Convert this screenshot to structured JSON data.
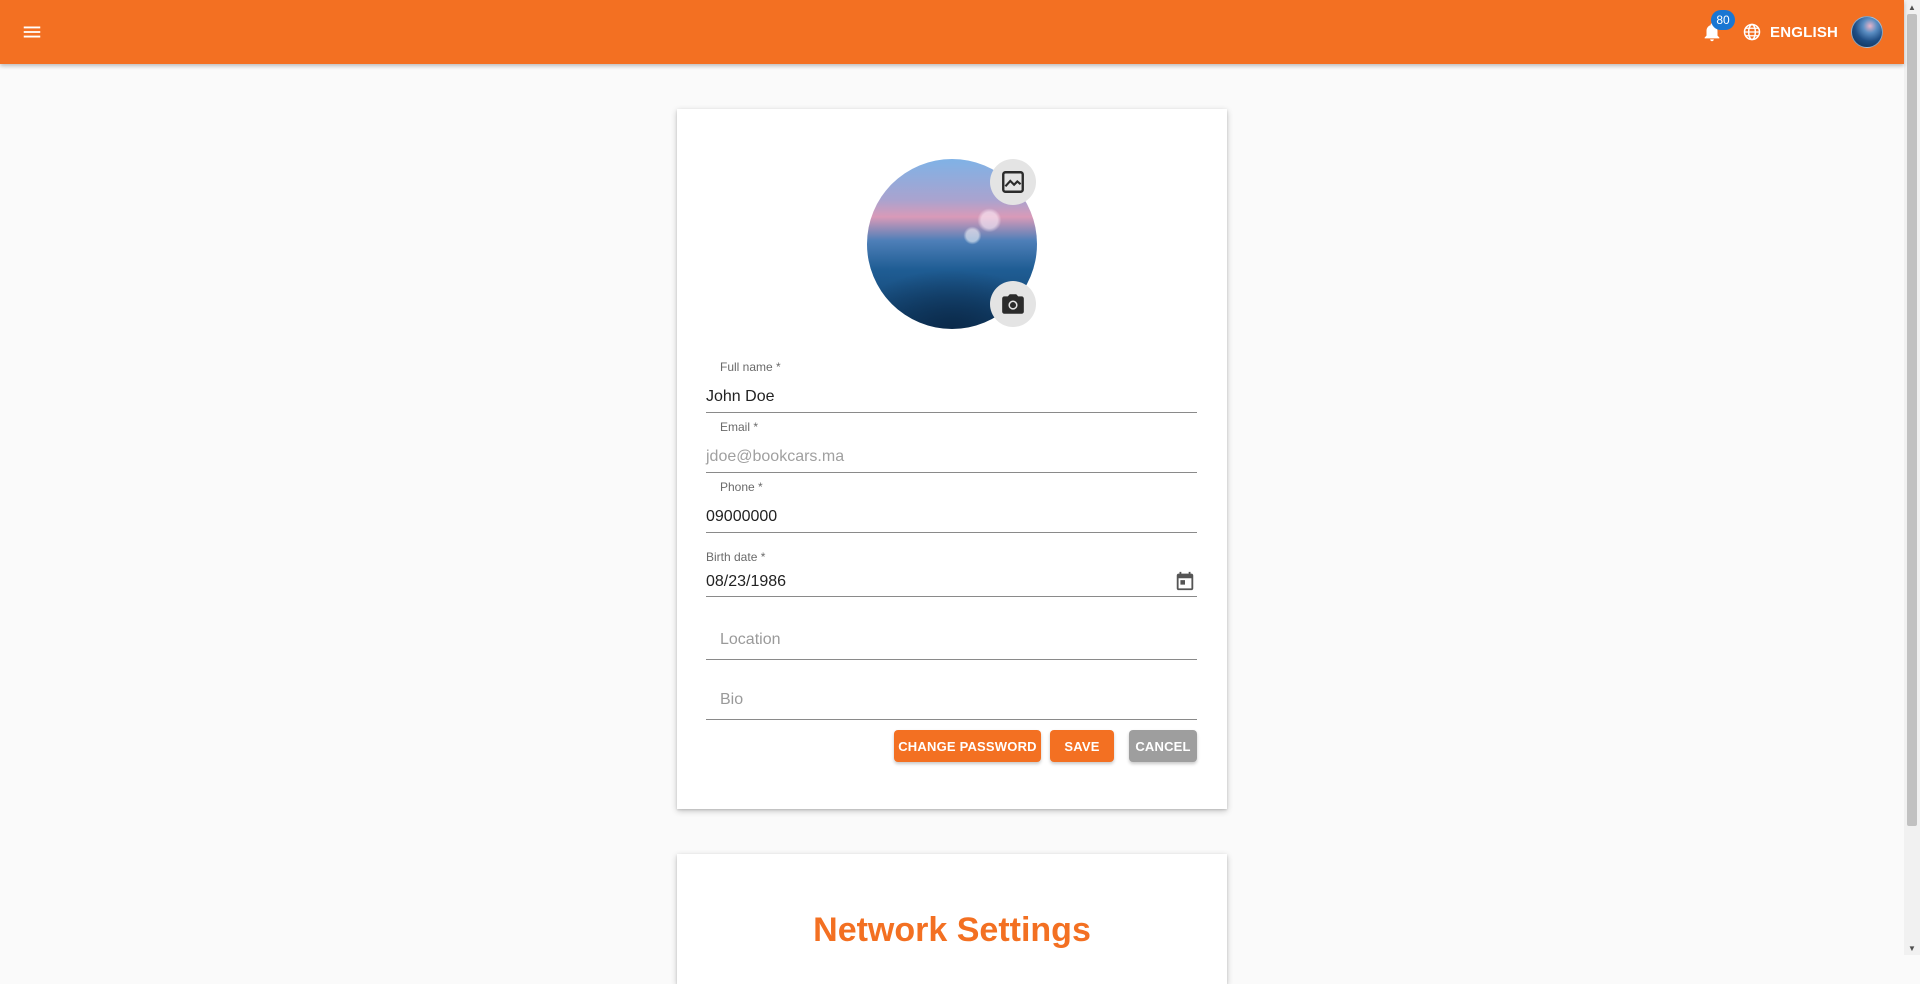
{
  "appbar": {
    "notification_count": "80",
    "language": "ENGLISH",
    "accent_color": "#f37022",
    "icons": [
      "menu-icon",
      "bell-icon",
      "globe-icon"
    ]
  },
  "profile": {
    "full_name": {
      "label": "Full name *",
      "value": "John Doe"
    },
    "email": {
      "label": "Email *",
      "value": "jdoe@bookcars.ma"
    },
    "phone": {
      "label": "Phone *",
      "value": "09000000"
    },
    "birth_date": {
      "label": "Birth date *",
      "value": "08/23/1986"
    },
    "location": {
      "placeholder": "Location"
    },
    "bio": {
      "placeholder": "Bio"
    },
    "actions": {
      "change_password": "CHANGE PASSWORD",
      "save": "SAVE",
      "cancel": "CANCEL"
    }
  },
  "network": {
    "title": "Network Settings"
  }
}
